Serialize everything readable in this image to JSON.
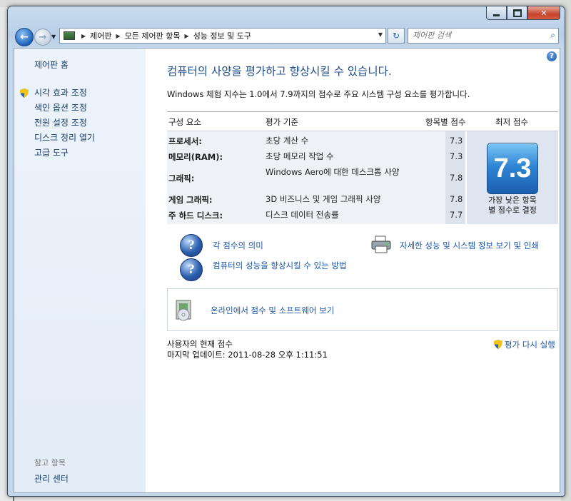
{
  "window": {
    "title_controls": {
      "minimize": "minimize",
      "maximize": "maximize",
      "close": "close"
    }
  },
  "nav": {
    "breadcrumb": [
      "제어판",
      "모든 제어판 항목",
      "성능 정보 및 도구"
    ],
    "search_placeholder": "제어판 검색"
  },
  "sidebar": {
    "home": "제어판 홈",
    "items": [
      {
        "label": "시각 효과 조정",
        "shield": true
      },
      {
        "label": "색인 옵션 조정",
        "shield": false
      },
      {
        "label": "전원 설정 조정",
        "shield": false
      },
      {
        "label": "디스크 정리 열기",
        "shield": false
      },
      {
        "label": "고급 도구",
        "shield": false
      }
    ],
    "see_also": "참고 항목",
    "action_center": "관리 센터"
  },
  "main": {
    "heading": "컴퓨터의 사양을 평가하고 향상시킬 수 있습니다.",
    "description": "Windows 체험 지수는 1.0에서 7.9까지의 점수로 주요 시스템 구성 요소를 평가합니다.",
    "table": {
      "headers": {
        "component": "구성 요소",
        "criteria": "평가 기준",
        "subscore": "항목별 점수",
        "base": "최저 점수"
      },
      "rows": [
        {
          "component": "프로세서:",
          "criteria": "초당 계산 수",
          "score": "7.3"
        },
        {
          "component": "메모리(RAM):",
          "criteria": "초당 메모리 작업 수",
          "score": "7.3"
        },
        {
          "component": "그래픽:",
          "criteria": "Windows Aero에 대한 데스크톱 사양",
          "score": "7.8"
        },
        {
          "component": "게임 그래픽:",
          "criteria": "3D 비즈니스 및 게임 그래픽 사양",
          "score": "7.8"
        },
        {
          "component": "주 하드 디스크:",
          "criteria": "디스크 데이터 전송률",
          "score": "7.7"
        }
      ],
      "base_score": "7.3",
      "base_caption_line1": "가장 낮은 항목",
      "base_caption_line2": "별 점수로 결정"
    },
    "links": {
      "meaning": "각 점수의 의미",
      "improve": "컴퓨터의 성능을 향상시킬 수 있는 방법",
      "details": "자세한 성능 및 시스템 정보 보기 및 인쇄",
      "online": "온라인에서 점수 및 소프트웨어 보기",
      "rerun": "평가 다시 실행"
    },
    "status": {
      "current": "사용자의 현재 점수",
      "last_update": "마지막 업데이트: 2011-08-28 오후 1:11:51"
    }
  },
  "colors": {
    "accent": "#1e4e8c",
    "link": "#1a56ab",
    "badge": "#2f86d4"
  }
}
